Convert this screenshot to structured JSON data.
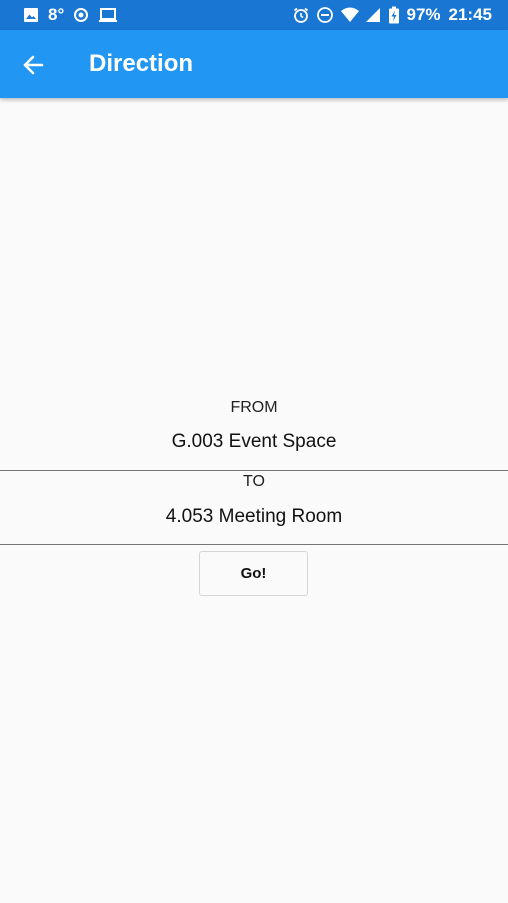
{
  "status_bar": {
    "temperature": "8°",
    "battery": "97%",
    "time": "21:45",
    "left_icons": [
      "image-icon",
      "record-icon",
      "laptop-icon"
    ],
    "right_icons": [
      "alarm-icon",
      "do-not-disturb-icon",
      "wifi-icon",
      "signal-icon",
      "battery-charging-icon"
    ]
  },
  "app_bar": {
    "title": "Direction",
    "back_icon": "arrow-back-icon",
    "color": "#2196f3"
  },
  "form": {
    "from_label": "FROM",
    "from_value": "G.003 Event Space",
    "to_label": "TO",
    "to_value": "4.053 Meeting Room"
  },
  "actions": {
    "go_label": "Go!"
  },
  "colors": {
    "status_bar": "#1976d2",
    "app_bar": "#2196f3",
    "background": "#fafafa"
  }
}
